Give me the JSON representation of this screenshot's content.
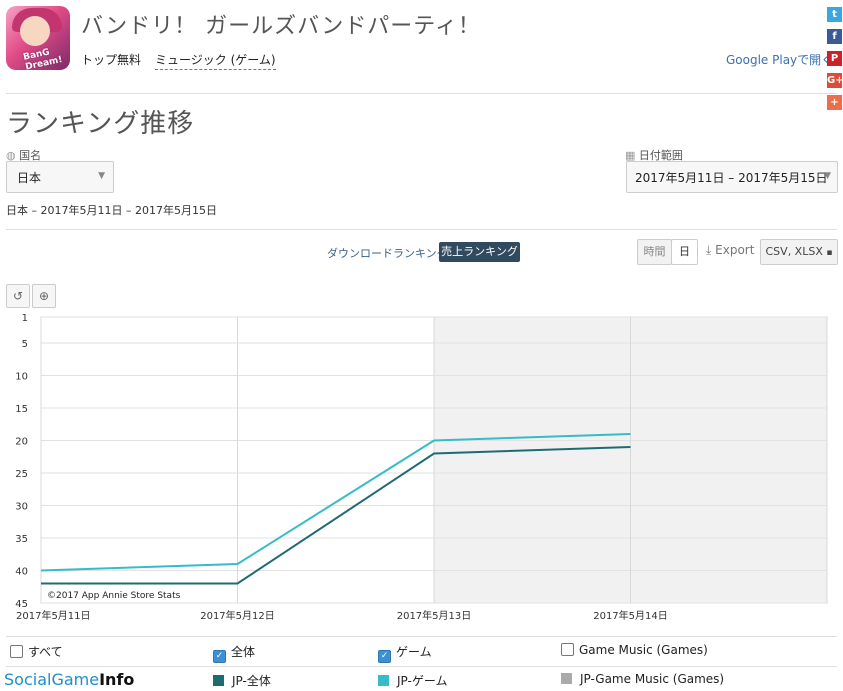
{
  "app": {
    "title": "バンドリ！ ガールズバンドパーティ！",
    "icon_text": "BanG Dream!",
    "crumb_rank": "トップ無料",
    "crumb_category": "ミュージック (ゲーム)",
    "store_link": "Google Playで開く"
  },
  "share": [
    {
      "icon": "twitter-icon",
      "glyph": "t",
      "color": "#3aa7e3"
    },
    {
      "icon": "facebook-icon",
      "glyph": "f",
      "color": "#3b5a98"
    },
    {
      "icon": "pinterest-icon",
      "glyph": "P",
      "color": "#cc2127"
    },
    {
      "icon": "google-plus-icon",
      "glyph": "G+",
      "color": "#dd4b39"
    },
    {
      "icon": "more-share-icon",
      "glyph": "+",
      "color": "#ee6e4b"
    }
  ],
  "section": {
    "title": "ランキング推移",
    "country_label": "国名",
    "country_value": "日本",
    "date_label": "日付範囲",
    "date_value": "2017年5月11日 – 2017年5月15日",
    "subtitle": "日本 – 2017年5月11日 – 2017年5月15日"
  },
  "tabs": {
    "download": "ダウンロードランキング",
    "revenue": "売上ランキング"
  },
  "controls": {
    "hour": "時間",
    "day": "日",
    "export": "Export",
    "csv": "CSV, XLSX"
  },
  "chart_data": {
    "type": "line",
    "x": [
      "2017年5月11日",
      "2017年5月12日",
      "2017年5月13日",
      "2017年5月14日"
    ],
    "yticks": [
      1,
      5,
      10,
      15,
      20,
      25,
      30,
      35,
      40,
      45
    ],
    "ylim": [
      1,
      45
    ],
    "y_inverted": true,
    "grid": true,
    "credit": "©2017 App Annie Store Stats",
    "series": [
      {
        "name": "JP-全体",
        "color": "#1f6b72",
        "values": [
          42,
          42,
          22,
          21
        ]
      },
      {
        "name": "JP-ゲーム",
        "color": "#35bcc6",
        "values": [
          40,
          39,
          20,
          19
        ]
      },
      {
        "name": "JP-Game Music (Games)",
        "color": "#aaaaaa",
        "values": []
      }
    ]
  },
  "legend": {
    "all": "すべて",
    "overall": "全体",
    "game": "ゲーム",
    "game_music": "Game Music (Games)",
    "items": [
      {
        "label": "JP-全体",
        "color": "#1f6b72"
      },
      {
        "label": "JP-ゲーム",
        "color": "#35bcc6"
      },
      {
        "label": "JP-Game Music (Games)",
        "color": "#aaaaaa"
      }
    ]
  },
  "watermark": {
    "part1": "Social",
    "part2": "Game",
    "part3": "Info"
  }
}
